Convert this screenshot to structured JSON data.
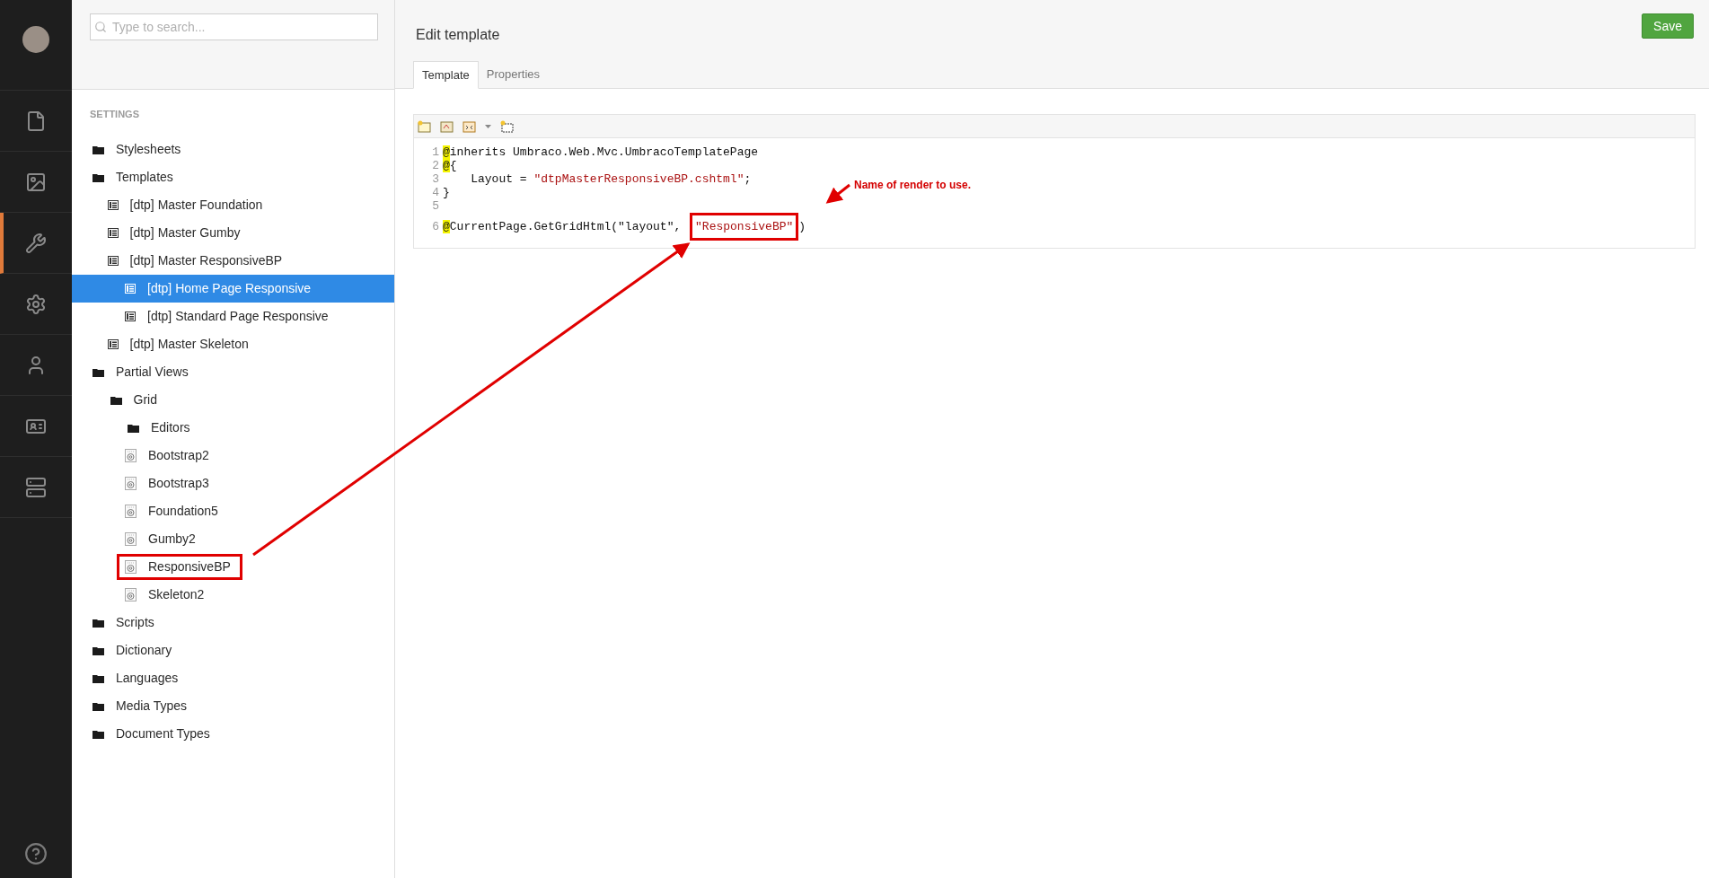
{
  "nav": {
    "items": [
      {
        "kind": "document",
        "selected": false
      },
      {
        "kind": "media",
        "selected": false
      },
      {
        "kind": "settings-wrench",
        "selected": true
      },
      {
        "kind": "developer-gear",
        "selected": false
      },
      {
        "kind": "users",
        "selected": false
      },
      {
        "kind": "members",
        "selected": false
      },
      {
        "kind": "forms",
        "selected": false
      }
    ]
  },
  "tree": {
    "search": {
      "placeholder": "Type to search..."
    },
    "section": "SETTINGS",
    "items": [
      {
        "label": "Stylesheets",
        "kind": "folder",
        "selected": false,
        "annotated": false
      },
      {
        "label": "Templates",
        "kind": "folder",
        "selected": false,
        "annotated": false,
        "children": [
          {
            "label": "[dtp] Master Foundation",
            "kind": "template",
            "selected": false,
            "annotated": false
          },
          {
            "label": "[dtp] Master Gumby",
            "kind": "template",
            "selected": false,
            "annotated": false
          },
          {
            "label": "[dtp] Master ResponsiveBP",
            "kind": "template",
            "selected": false,
            "annotated": false,
            "children": [
              {
                "label": "[dtp] Home Page Responsive",
                "kind": "template",
                "selected": true,
                "annotated": false
              },
              {
                "label": "[dtp] Standard Page Responsive",
                "kind": "template",
                "selected": false,
                "annotated": false
              }
            ]
          },
          {
            "label": "[dtp] Master Skeleton",
            "kind": "template",
            "selected": false,
            "annotated": false
          }
        ]
      },
      {
        "label": "Partial Views",
        "kind": "folder",
        "selected": false,
        "annotated": false,
        "children": [
          {
            "label": "Grid",
            "kind": "folder",
            "selected": false,
            "annotated": false,
            "children": [
              {
                "label": "Editors",
                "kind": "folder",
                "selected": false,
                "annotated": false
              },
              {
                "label": "Bootstrap2",
                "kind": "partial",
                "selected": false,
                "annotated": false
              },
              {
                "label": "Bootstrap3",
                "kind": "partial",
                "selected": false,
                "annotated": false
              },
              {
                "label": "Foundation5",
                "kind": "partial",
                "selected": false,
                "annotated": false
              },
              {
                "label": "Gumby2",
                "kind": "partial",
                "selected": false,
                "annotated": false
              },
              {
                "label": "ResponsiveBP",
                "kind": "partial",
                "selected": false,
                "annotated": true
              },
              {
                "label": "Skeleton2",
                "kind": "partial",
                "selected": false,
                "annotated": false
              }
            ]
          }
        ]
      },
      {
        "label": "Scripts",
        "kind": "folder",
        "selected": false,
        "annotated": false
      },
      {
        "label": "Dictionary",
        "kind": "folder",
        "selected": false,
        "annotated": false
      },
      {
        "label": "Languages",
        "kind": "folder",
        "selected": false,
        "annotated": false
      },
      {
        "label": "Media Types",
        "kind": "folder",
        "selected": false,
        "annotated": false
      },
      {
        "label": "Document Types",
        "kind": "folder",
        "selected": false,
        "annotated": false
      }
    ]
  },
  "editor": {
    "title": "Edit template",
    "save": "Save",
    "tabs": [
      {
        "label": "Template",
        "selected": true
      },
      {
        "label": "Properties",
        "selected": false
      }
    ],
    "code": [
      {
        "number": "1",
        "tokens": [
          {
            "kind": "at",
            "text": "@"
          },
          {
            "kind": "plain",
            "text": "inherits Umbraco.Web.Mvc.UmbracoTemplatePage"
          }
        ]
      },
      {
        "number": "2",
        "tokens": [
          {
            "kind": "at",
            "text": "@"
          },
          {
            "kind": "plain",
            "text": "{"
          }
        ]
      },
      {
        "number": "3",
        "tokens": [
          {
            "kind": "plain",
            "text": "    Layout = "
          },
          {
            "kind": "string",
            "text": "\"dtpMasterResponsiveBP.cshtml\""
          },
          {
            "kind": "plain",
            "text": ";"
          }
        ]
      },
      {
        "number": "4",
        "tokens": [
          {
            "kind": "plain",
            "text": "}"
          }
        ]
      },
      {
        "number": "5"
      },
      {
        "number": "6",
        "tokens": [
          {
            "kind": "at",
            "text": "@"
          },
          {
            "kind": "plain",
            "text": "CurrentPage.GetGridHtml(\"layout\", "
          },
          {
            "kind": "string",
            "text": "\"ResponsiveBP\"",
            "annotated": true
          },
          {
            "kind": "plain",
            "text": ")"
          }
        ]
      }
    ]
  },
  "annotation": {
    "text": "Name of render to use."
  }
}
